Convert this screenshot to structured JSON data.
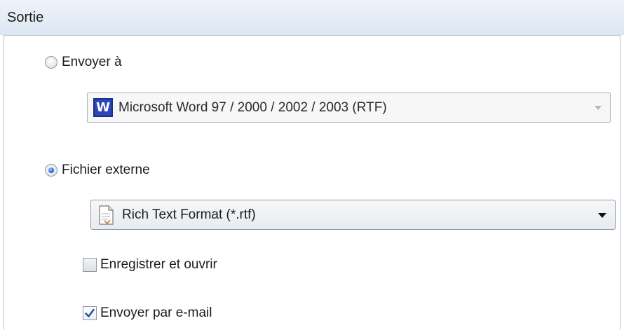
{
  "section": {
    "title": "Sortie"
  },
  "send_to": {
    "radio_label": "Envoyer à",
    "checked": false,
    "select_value": "Microsoft Word 97 / 2000 / 2002 / 2003 (RTF)",
    "select_icon": "word-icon",
    "disabled": true
  },
  "external_file": {
    "radio_label": "Fichier externe",
    "checked": true,
    "select_value": "Rich Text Format (*.rtf)",
    "select_icon": "rtf-file-icon"
  },
  "options": {
    "save_open": {
      "label": "Enregistrer et ouvrir",
      "checked": false
    },
    "email": {
      "label": "Envoyer par e-mail",
      "checked": true
    }
  },
  "colors": {
    "accent": "#2f6fcf",
    "header_bg": "#dde7f2",
    "check_mark": "#1f4f9c"
  }
}
